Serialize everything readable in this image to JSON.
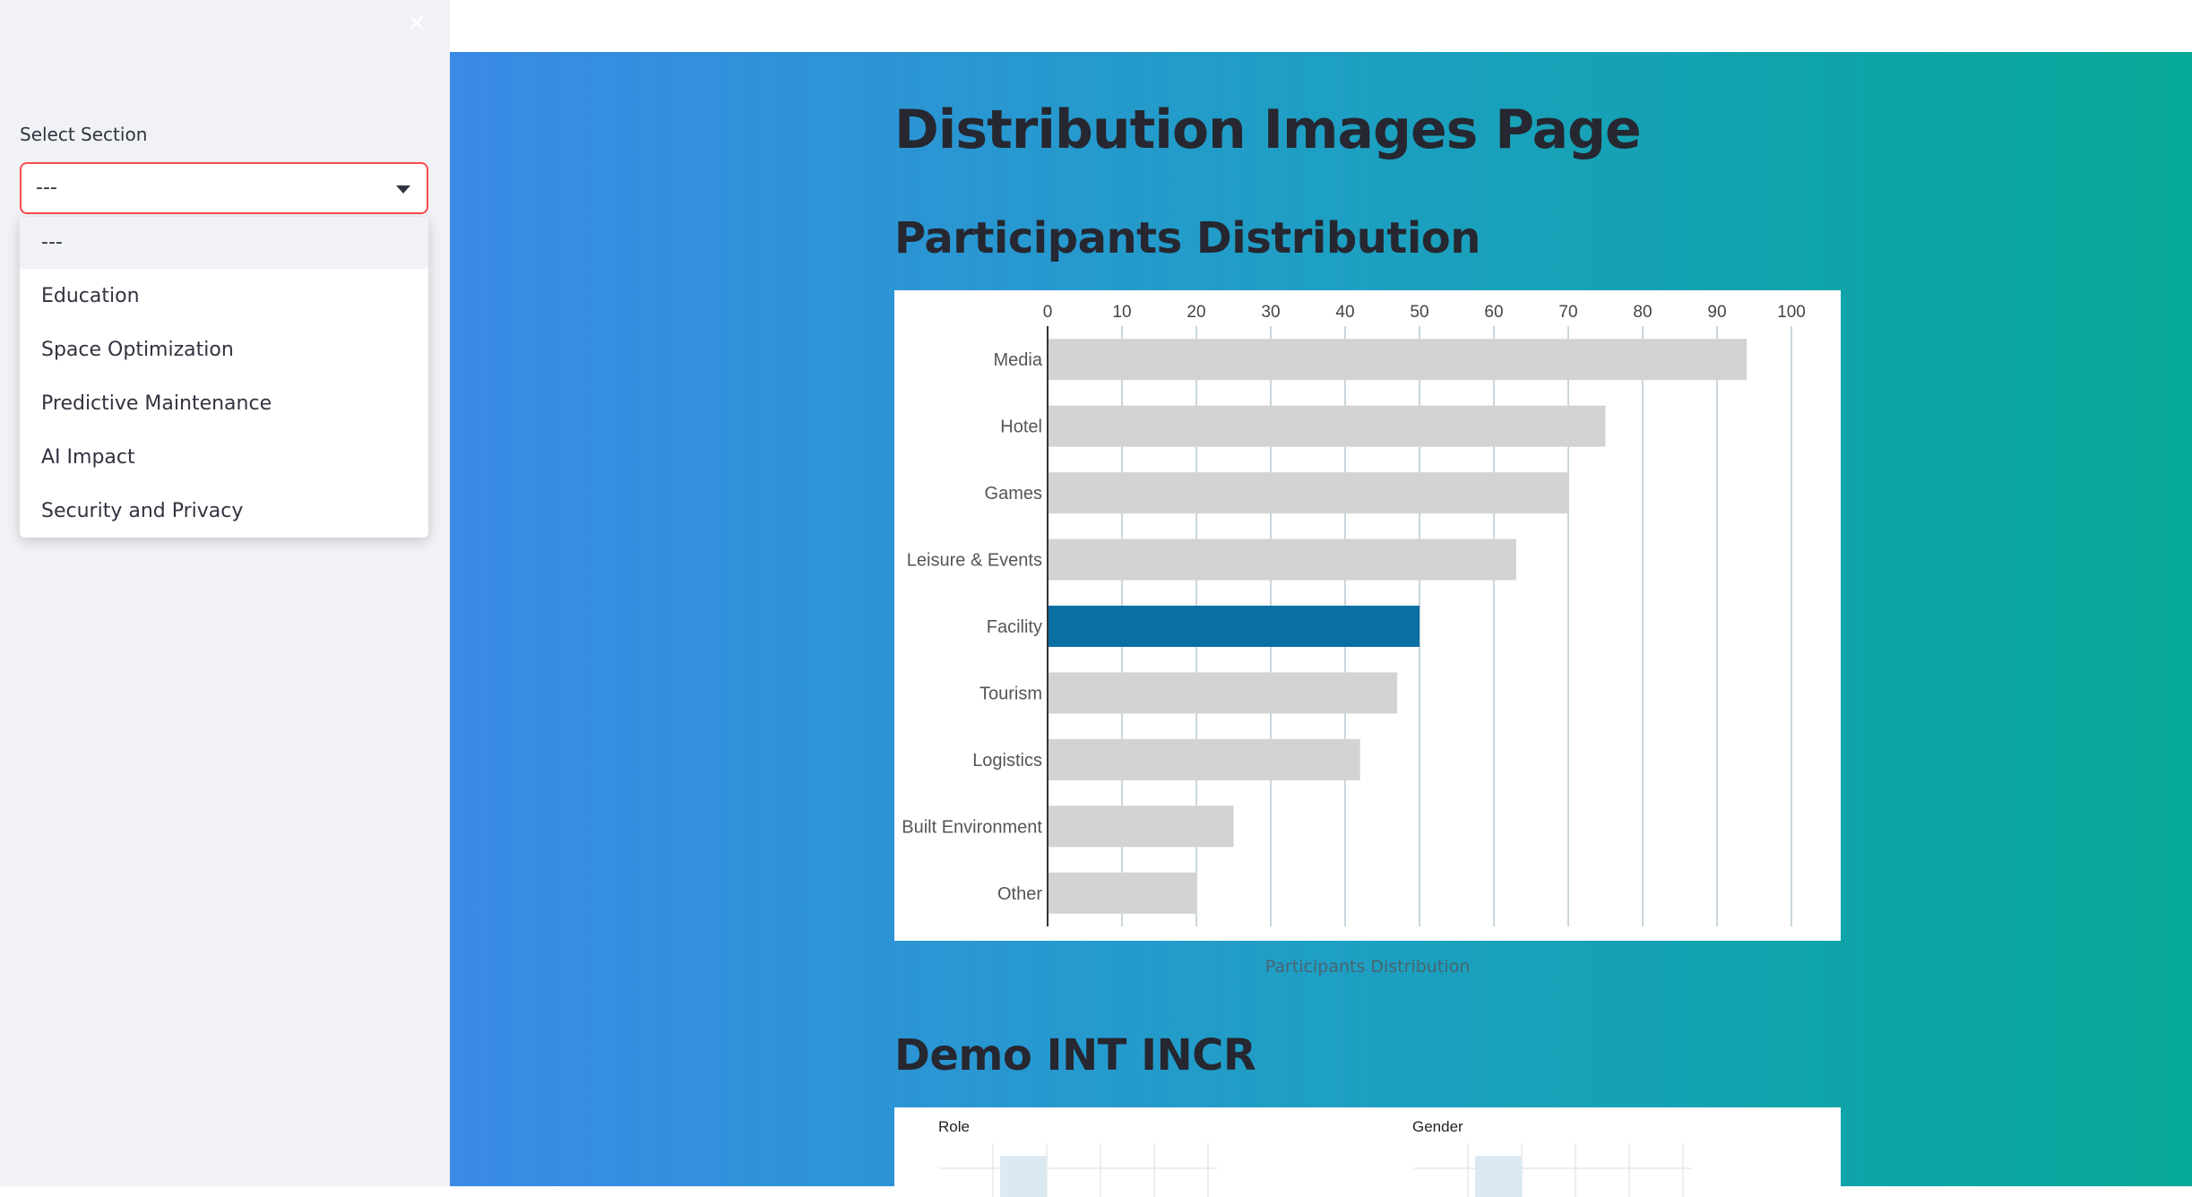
{
  "sidebar": {
    "close_icon": "close-icon",
    "select_label": "Select Section",
    "select_value": "---",
    "options": [
      "---",
      "Education",
      "Space Optimization",
      "Predictive Maintenance",
      "AI Impact",
      "Security and Privacy"
    ]
  },
  "main": {
    "title": "Distribution Images Page",
    "section1_title": "Participants Distribution",
    "chart_caption": "Participants Distribution",
    "section2_title": "Demo INT INCR",
    "demo_panel_titles": [
      "Role",
      "Gender"
    ]
  },
  "colors": {
    "accent_border": "#ff4b4b",
    "bar_default": "#d3d3d3",
    "bar_highlight": "#0a6fa3",
    "gradient_start": "#3a8ae6",
    "gradient_end": "#06a898"
  },
  "chart_data": {
    "type": "bar",
    "orientation": "horizontal",
    "categories": [
      "Media",
      "Hotel",
      "Games",
      "Leisure & Events",
      "Facility",
      "Tourism",
      "Logistics",
      "Built Environment",
      "Other"
    ],
    "values": [
      94,
      75,
      70,
      63,
      50,
      47,
      42,
      25,
      20
    ],
    "highlight": "Facility",
    "xlim": [
      0,
      100
    ],
    "xticks": [
      0,
      10,
      20,
      30,
      40,
      50,
      60,
      70,
      80,
      90,
      100
    ],
    "grid": true,
    "axis_position": "top"
  }
}
